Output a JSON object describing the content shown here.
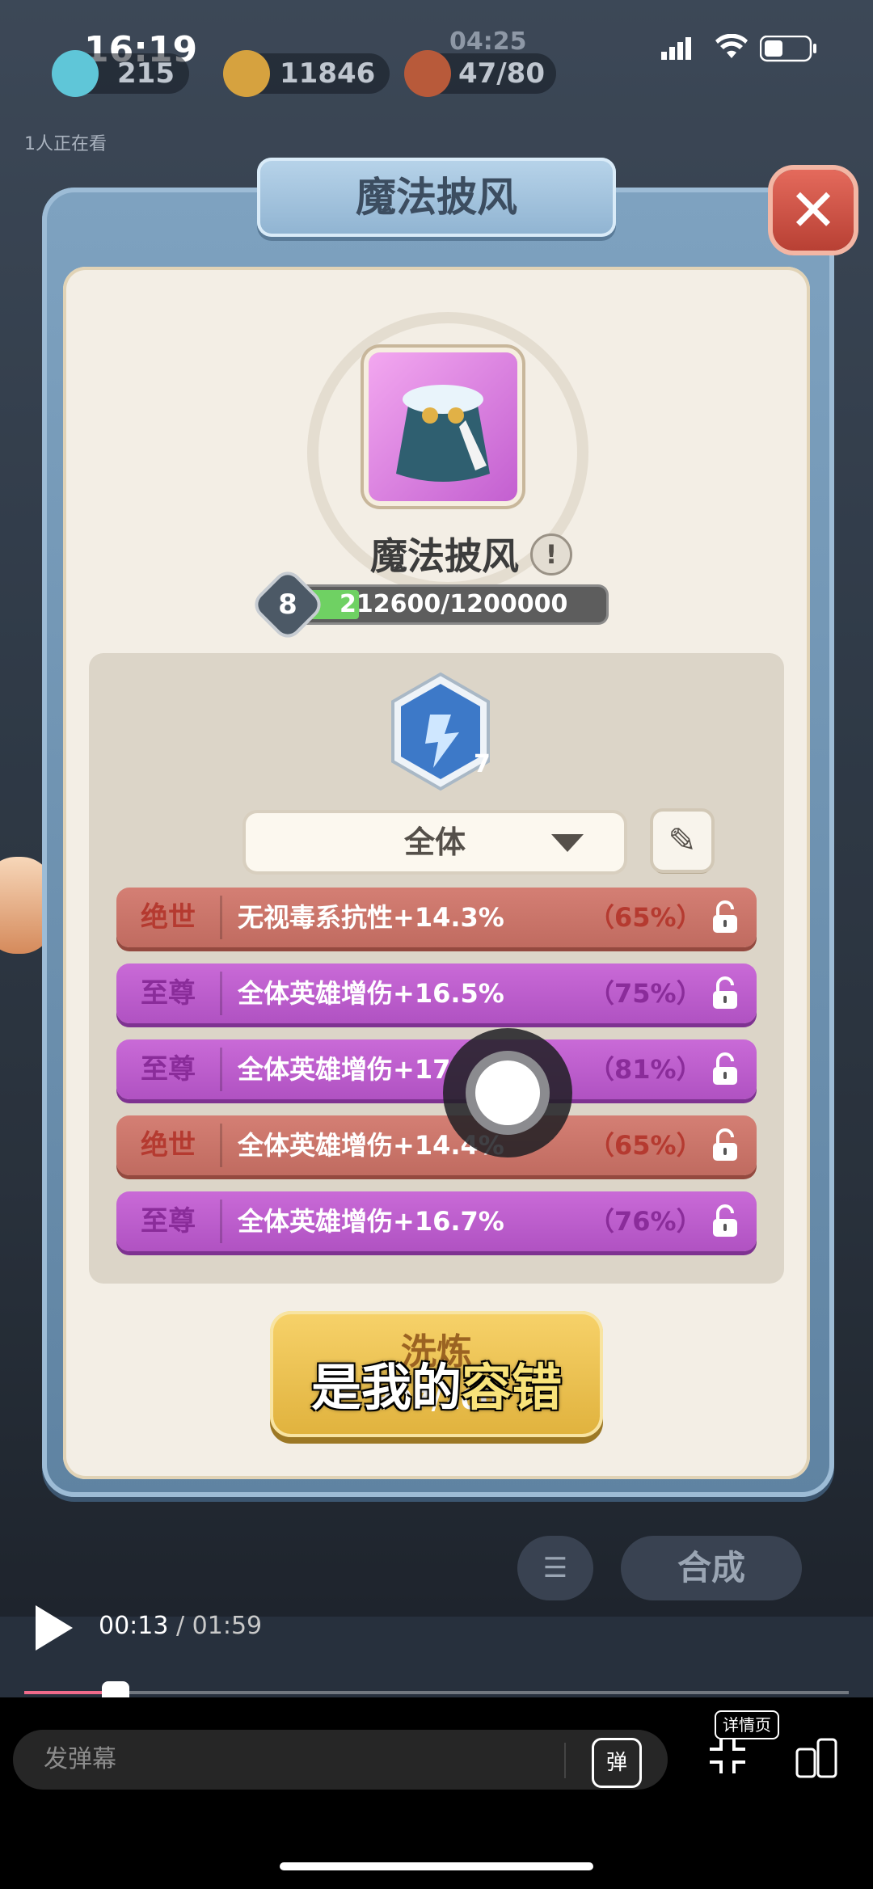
{
  "status_bar": {
    "time": "16:19"
  },
  "resources": {
    "gems": "215",
    "coins": "11846",
    "timer": "04:25",
    "stamina": "47/80"
  },
  "viewers": "1人正在看",
  "modal": {
    "title": "魔法披风",
    "close_icon": "close-icon",
    "item": {
      "name": "魔法披风",
      "level": "8",
      "exp": "212600/1200000",
      "exp_fraction": 0.177
    },
    "rune": {
      "count": "7"
    },
    "filter": {
      "selected": "全体"
    },
    "stats": [
      {
        "tier": "绝世",
        "desc": "无视毒系抗性+14.3%",
        "pct": "（65%）",
        "color": "red"
      },
      {
        "tier": "至尊",
        "desc": "全体英雄增伤+16.5%",
        "pct": "（75%）",
        "color": "purple"
      },
      {
        "tier": "至尊",
        "desc": "全体英雄增伤+17",
        "pct": "（81%）",
        "color": "purple"
      },
      {
        "tier": "绝世",
        "desc": "全体英雄增伤+14.4%",
        "pct": "（65%）",
        "color": "red"
      },
      {
        "tier": "至尊",
        "desc": "全体英雄增伤+16.7%",
        "pct": "（76%）",
        "color": "purple"
      }
    ],
    "refine_button": {
      "label": "洗炼",
      "cost": "307/200"
    }
  },
  "subtitle": {
    "part1": "是我的",
    "part2": "容错"
  },
  "game_bottom": {
    "merge_label": "合成"
  },
  "video": {
    "current": "00:13",
    "separator": " / ",
    "total": "01:59",
    "progress_fraction": 0.11,
    "danmaku_placeholder": "发弹幕",
    "danmaku_toggle": "弹",
    "detail_label": "详情页"
  },
  "colors": {
    "red_row": "#c8746a",
    "purple_row": "#b95cca",
    "progress": "#f06b8b"
  }
}
